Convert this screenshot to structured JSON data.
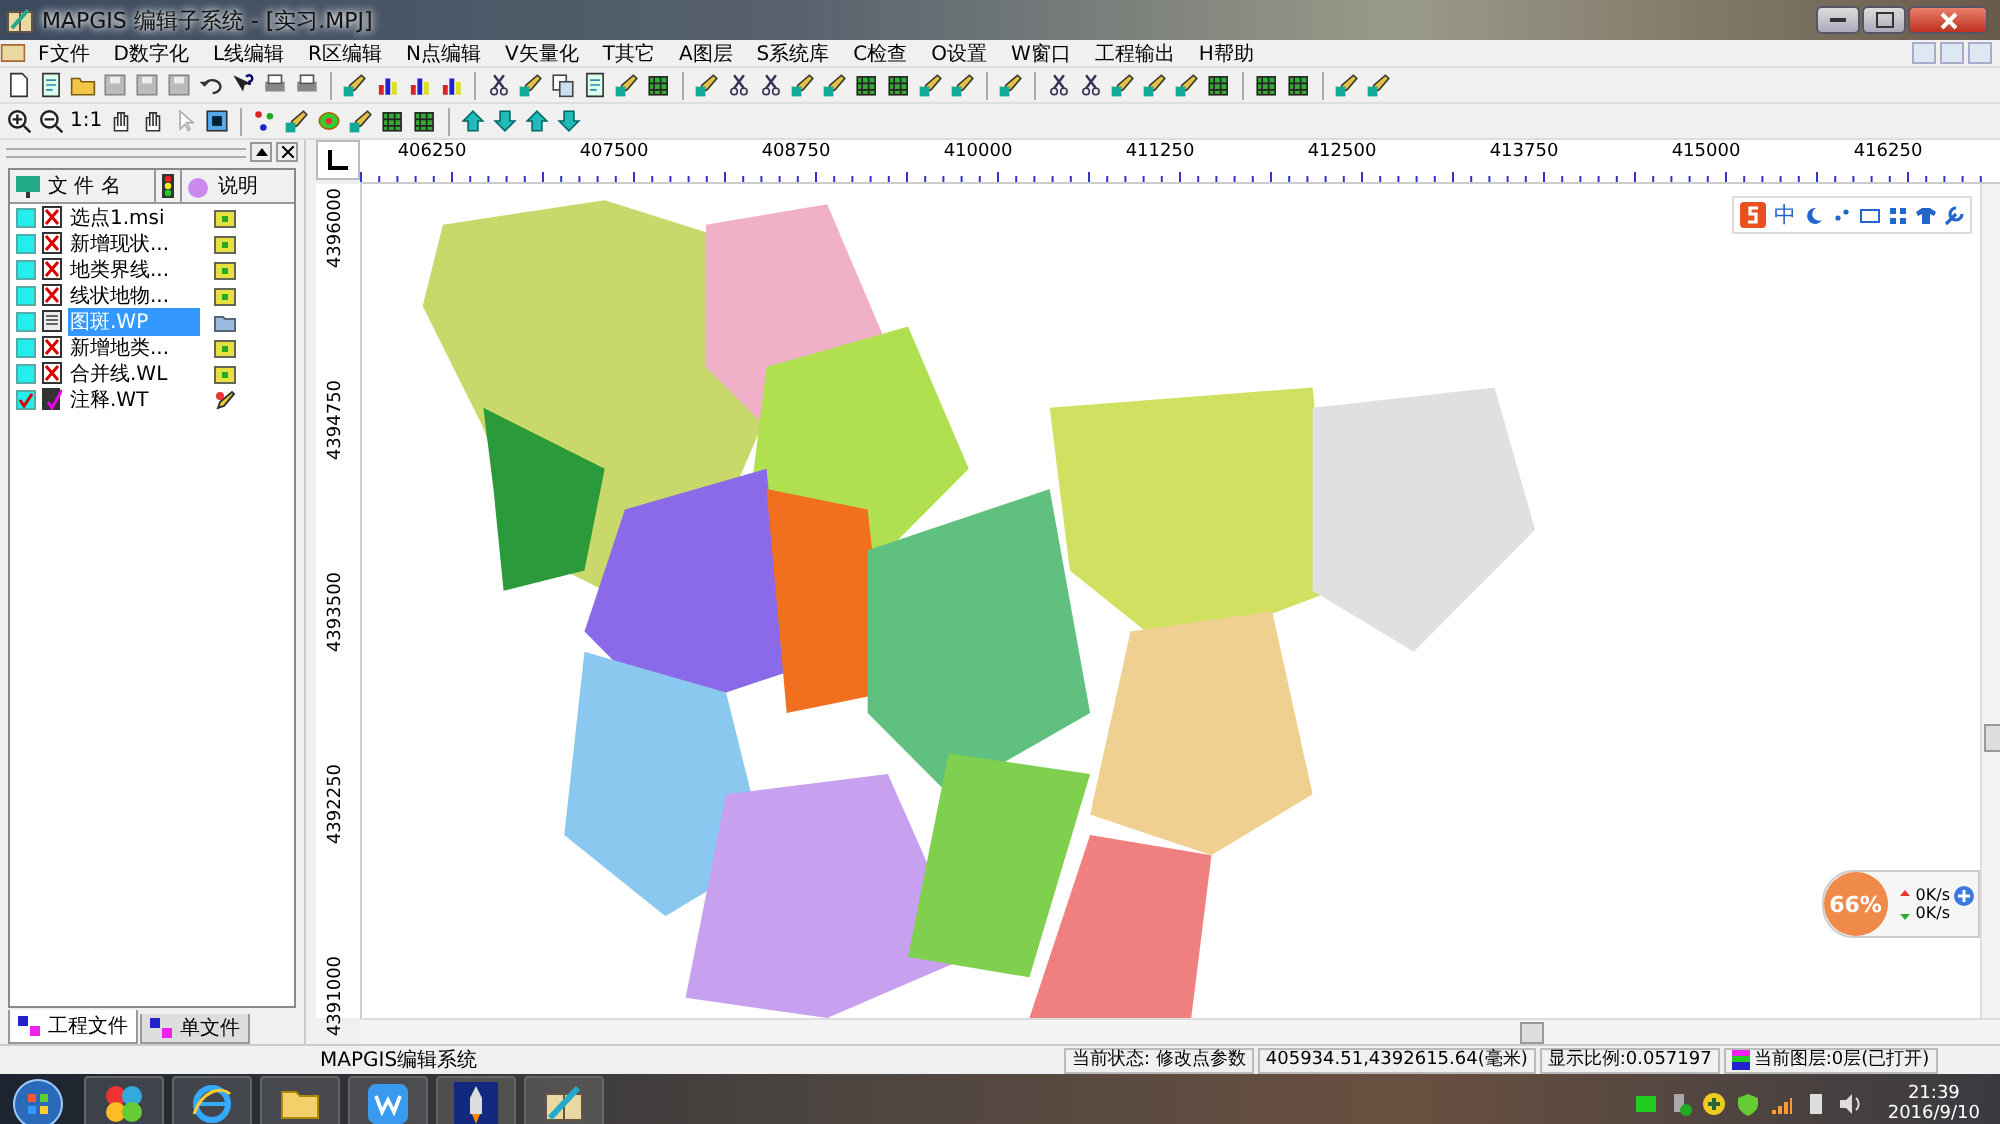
{
  "window": {
    "title": "MAPGIS 编辑子系统 - [实习.MPJ]"
  },
  "menu": [
    "F文件",
    "D数字化",
    "L线编辑",
    "R区编辑",
    "N点编辑",
    "V矢量化",
    "T其它",
    "A图层",
    "S系统库",
    "C检查",
    "O设置",
    "W窗口",
    "工程输出",
    "H帮助"
  ],
  "toolbar2": {
    "scale_label": "1:1"
  },
  "file_panel": {
    "columns": [
      "文 件 名",
      "说明"
    ],
    "files": [
      {
        "name": "选点1.msi",
        "kind": "closed",
        "checked": false,
        "selected": false
      },
      {
        "name": "新增现状...",
        "kind": "closed",
        "checked": false,
        "selected": false
      },
      {
        "name": "地类界线...",
        "kind": "closed",
        "checked": false,
        "selected": false
      },
      {
        "name": "线状地物...",
        "kind": "closed",
        "checked": false,
        "selected": false
      },
      {
        "name": "图斑.WP",
        "kind": "open",
        "checked": false,
        "selected": true
      },
      {
        "name": "新增地类...",
        "kind": "closed",
        "checked": false,
        "selected": false
      },
      {
        "name": "合并线.WL",
        "kind": "closed",
        "checked": false,
        "selected": false
      },
      {
        "name": "注释.WT",
        "kind": "note",
        "checked": true,
        "selected": false
      }
    ],
    "tabs": [
      {
        "label": "工程文件",
        "selected": true
      },
      {
        "label": "单文件",
        "selected": false
      }
    ]
  },
  "ruler": {
    "x_labels": [
      "406250",
      "407500",
      "408750",
      "410000",
      "411250",
      "412500",
      "413750",
      "415000",
      "416250"
    ],
    "y_labels": [
      "4396000",
      "4394750",
      "4393500",
      "4392250",
      "4391000"
    ]
  },
  "ime_bar": {
    "mode": "中"
  },
  "net_widget": {
    "percent": "66%",
    "upload": "0K/s",
    "download": "0K/s"
  },
  "status_bar": {
    "app": "MAPGIS编辑系统",
    "state": "当前状态: 修改点参数",
    "coords": "405934.51,4392615.64(毫米)",
    "scale": "显示比例:0.057197",
    "layer": "当前图层:0层(已打开)"
  },
  "taskbar": {
    "time": "21:39",
    "date": "2016/9/10"
  }
}
